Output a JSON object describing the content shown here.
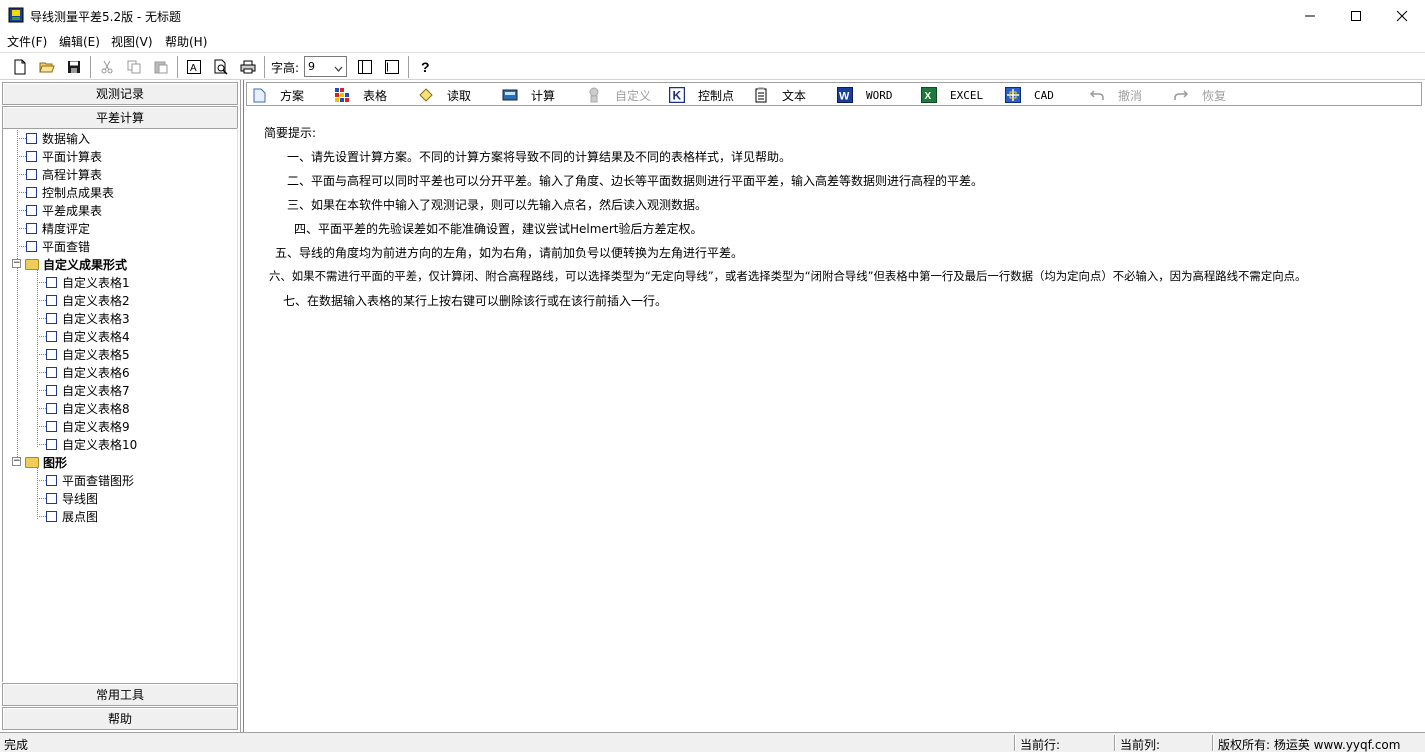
{
  "window": {
    "title": "导线测量平差5.2版 - 无标题"
  },
  "menu": [
    "文件(F)",
    "编辑(E)",
    "视图(V)",
    "帮助(H)"
  ],
  "toolbar": {
    "font_label": "字高:",
    "font_size": "9"
  },
  "left_pane": {
    "header_top": "观测记录",
    "header_second": "平差计算",
    "footer_tools": "常用工具",
    "footer_help": "帮助"
  },
  "tree": {
    "items": [
      "数据输入",
      "平面计算表",
      "高程计算表",
      "控制点成果表",
      "平差成果表",
      "精度评定",
      "平面查错"
    ],
    "custom_folder": "自定义成果形式",
    "custom_items": [
      "自定义表格1",
      "自定义表格2",
      "自定义表格3",
      "自定义表格4",
      "自定义表格5",
      "自定义表格6",
      "自定义表格7",
      "自定义表格8",
      "自定义表格9",
      "自定义表格10"
    ],
    "graph_folder": "图形",
    "graph_items": [
      "平面查错图形",
      "导线图",
      "展点图"
    ]
  },
  "func_bar": {
    "plan": "方案",
    "table": "表格",
    "read": "读取",
    "calc": "计算",
    "custom": "自定义",
    "control": "控制点",
    "text": "文本",
    "word": "WORD",
    "excel": "EXCEL",
    "cad": "CAD",
    "undo": "撤消",
    "redo": "恢复"
  },
  "hints": {
    "title": "简要提示:",
    "lines": [
      "一、请先设置计算方案。不同的计算方案将导致不同的计算结果及不同的表格样式，详见帮助。",
      "二、平面与高程可以同时平差也可以分开平差。输入了角度、边长等平面数据则进行平面平差，输入高差等数据则进行高程的平差。",
      "三、如果在本软件中输入了观测记录，则可以先输入点名，然后读入观测数据。",
      "四、平面平差的先验误差如不能准确设置，建议尝试Helmert验后方差定权。",
      "五、导线的角度均为前进方向的左角，如为右角，请前加负号以便转换为左角进行平差。",
      "六、如果不需进行平面的平差，仅计算闭、附合高程路线，可以选择类型为“无定向导线”，或者选择类型为“闭附合导线”但表格中第一行及最后一行数据（均为定向点）不必输入，因为高程路线不需定向点。",
      "七、在数据输入表格的某行上按右键可以删除该行或在该行前插入一行。"
    ]
  },
  "status": {
    "ready": "完成",
    "current_row": "当前行:",
    "current_col": "当前列:",
    "copyright": "版权所有: 杨运英 www.yyqf.com"
  }
}
